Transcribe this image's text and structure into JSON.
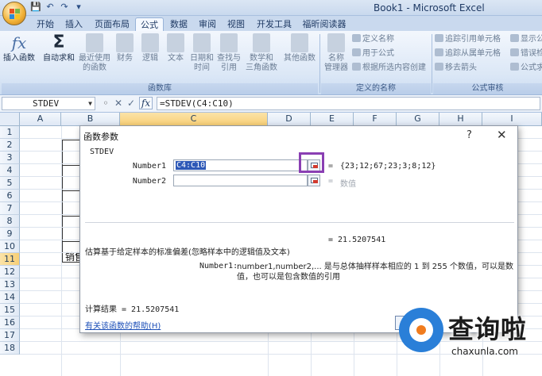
{
  "window": {
    "title": "Book1 - Microsoft Excel",
    "qat": [
      "save-icon",
      "undo-icon",
      "redo-icon",
      "customize-icon"
    ]
  },
  "ribbon": {
    "tabs": [
      "开始",
      "插入",
      "页面布局",
      "公式",
      "数据",
      "审阅",
      "视图",
      "开发工具",
      "福昕阅读器"
    ],
    "active_tab": "公式",
    "function_library": {
      "label": "函数库",
      "insert_function": "插入函数",
      "autosum": "自动求和",
      "recent_line1": "最近使用",
      "recent_line2": "的函数",
      "financial": "财务",
      "logical": "逻辑",
      "text": "文本",
      "datetime_line1": "日期和",
      "datetime_line2": "时间",
      "lookup_line1": "查找与",
      "lookup_line2": "引用",
      "math_line1": "数学和",
      "math_line2": "三角函数",
      "other": "其他函数"
    },
    "defined_names": {
      "label": "定义的名称",
      "name_manager_line1": "名称",
      "name_manager_line2": "管理器",
      "define_name": "定义名称",
      "use_in_formula": "用于公式",
      "create_from_selection": "根据所选内容创建"
    },
    "formula_auditing": {
      "label": "公式审核",
      "trace_precedents": "追踪引用单元格",
      "trace_dependents": "追踪从属单元格",
      "remove_arrows": "移去箭头",
      "show_formulas": "显示公",
      "error_checking": "错误检",
      "evaluate_formula": "公式求"
    }
  },
  "formula_bar": {
    "name_box": "STDEV",
    "formula": "=STDEV(C4:C10)",
    "fx": "fx"
  },
  "grid": {
    "columns": [
      "A",
      "B",
      "C",
      "D",
      "E",
      "F",
      "G",
      "H",
      "I"
    ],
    "rows": [
      "1",
      "2",
      "3",
      "4",
      "5",
      "6",
      "7",
      "8",
      "9",
      "10",
      "11",
      "12",
      "13",
      "14",
      "15",
      "16",
      "17",
      "18"
    ],
    "selected_column": "C",
    "selected_row": "11",
    "cell_b11": "销售"
  },
  "dialog": {
    "title": "函数参数",
    "help": "?",
    "close": "✕",
    "function_name": "STDEV",
    "arg1_label": "Number1",
    "arg1_value": "C4:C10",
    "arg1_result": "{23;12;67;23;3;8;12}",
    "arg2_label": "Number2",
    "arg2_result": "数值",
    "equals": "=",
    "result_top": "=  21.5207541",
    "description": "估算基于给定样本的标准偏差(忽略样本中的逻辑值及文本)",
    "arg_help_label": "Number1:",
    "arg_help": "number1,number2,...  是与总体抽样样本相应的 1 到 255 个数值，可以是数值，也可以是包含数值的引用",
    "calc_result": "计算结果 =  21.5207541",
    "help_link": "有关该函数的帮助(H)"
  },
  "watermark": {
    "cn": "查询啦",
    "en": "chaxunla.com"
  }
}
